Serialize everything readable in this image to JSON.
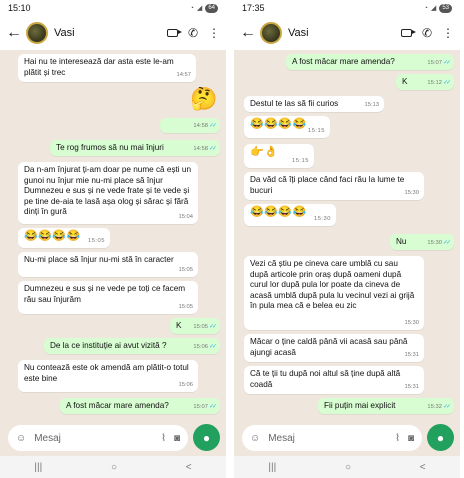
{
  "left": {
    "status_time": "15:10",
    "status_battery": "64",
    "contact_name": "Vasi",
    "input_placeholder": "Mesaj",
    "messages": [
      {
        "text": "Hai nu te interesează dar asta este le-am plătit și trec",
        "time": "14:57"
      },
      {
        "text": "🤔",
        "time": ""
      },
      {
        "text": "",
        "time": "14:58"
      },
      {
        "text": "Te rog frumos să nu mai înjuri",
        "time": "14:58"
      },
      {
        "text": "Da n-am înjurat ți-am doar pe nume că ești un gunoi nu înjur mie nu-mi place să înjur Dumnezeu e sus și ne vede frate și te vede și pe tine de-aia te lasă așa olog și sărac și fără dinți în gură",
        "time": "15:04"
      },
      {
        "text": "😂😂😂😂",
        "time": "15:05"
      },
      {
        "text": "Nu-mi place să înjur nu-mi stă în caracter",
        "time": "15:05"
      },
      {
        "text": "Dumnezeu e sus și ne vede pe toți ce facem rău sau înjurăm",
        "time": "15:05"
      },
      {
        "text": "K",
        "time": "15:05"
      },
      {
        "text": "De la ce instituție ai avut vizită ?",
        "time": "15:06"
      },
      {
        "text": "Nu contează este ok amendă am plătit-o totul este bine",
        "time": "15:06"
      },
      {
        "text": "A fost măcar mare amenda?",
        "time": "15:07"
      }
    ]
  },
  "right": {
    "status_time": "17:35",
    "status_battery": "53",
    "contact_name": "Vasi",
    "input_placeholder": "Mesaj",
    "messages": [
      {
        "text": "A fost măcar mare amenda?",
        "time": "15:07"
      },
      {
        "text": "K",
        "time": "15:12"
      },
      {
        "text": "Destul te las să fii curios",
        "time": "15:13"
      },
      {
        "text": "😂😂😂😂",
        "time": "15:15"
      },
      {
        "text": "👉👌",
        "time": "15:15"
      },
      {
        "text": "Da văd că îți place când faci rău la lume te bucuri",
        "time": "15:30"
      },
      {
        "text": "😂😂😂😂",
        "time": "15:30"
      },
      {
        "text": "Nu",
        "time": "15:30"
      },
      {
        "text": "Vezi că știu pe cineva care umblă cu sau după articole prin oraș după oameni după curul lor după pula lor poate da cineva de acasă umblă după pula lu vecinul vezi ai grijă în pula mea că e belea eu zic",
        "time": "15:30"
      },
      {
        "text": "Măcar o ține caldă până vii acasă sau până ajungi acasă",
        "time": "15:31"
      },
      {
        "text": "Că te ții tu după noi altul să ține după altă coadă",
        "time": "15:31"
      },
      {
        "text": "Fii puțin mai explicit",
        "time": "15:32"
      }
    ]
  },
  "colors": {
    "incoming": "#ffffff",
    "outgoing": "#d8fdd2",
    "accent": "#21a05e",
    "read_ticks": "#34b7f1"
  },
  "icons": [
    "back-arrow-icon",
    "video-call-icon",
    "phone-icon",
    "more-vert-icon",
    "sticker-icon",
    "attach-icon",
    "camera-icon",
    "mic-icon",
    "recents-icon",
    "home-icon",
    "back-nav-icon"
  ]
}
